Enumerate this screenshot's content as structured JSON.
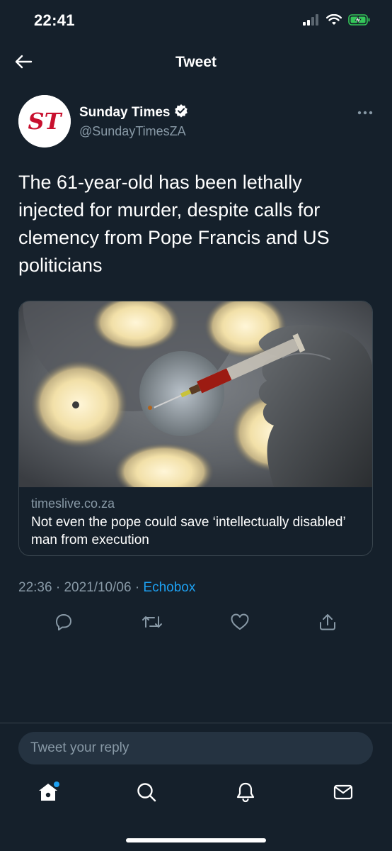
{
  "status_bar": {
    "time": "22:41"
  },
  "nav": {
    "title": "Tweet"
  },
  "tweet": {
    "author_name": "Sunday Times",
    "author_handle": "@SundayTimesZA",
    "avatar_text": "ST",
    "text": "The 61-year-old has been lethally injected for murder, despite calls for clemency from Pope Francis and US politicians",
    "card": {
      "domain": "timeslive.co.za",
      "title": "Not even the pope could save ‘intellectually disabled’ man from execution"
    },
    "time": "22:36",
    "date": "2021/10/06",
    "source": "Echobox",
    "separator": "·"
  },
  "reply": {
    "placeholder": "Tweet your reply"
  },
  "tabs": [
    "home-icon",
    "search-icon",
    "notifications-icon",
    "messages-icon"
  ],
  "colors": {
    "background": "#15202b",
    "accent": "#1da1f2",
    "muted": "#8899a6",
    "border": "#38444d",
    "avatar_red": "#c8102e",
    "battery": "#34c759"
  }
}
